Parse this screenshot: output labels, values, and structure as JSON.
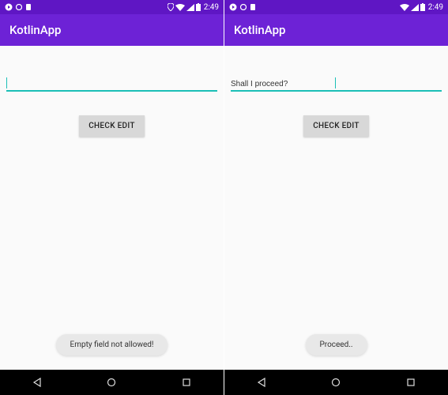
{
  "screens": [
    {
      "statusbar": {
        "time": "2:49"
      },
      "appbar": {
        "title": "KotlinApp"
      },
      "input": {
        "value": "",
        "has_cursor": true
      },
      "button": {
        "label": "CHECK EDIT"
      },
      "toast": {
        "message": "Empty field not allowed!"
      },
      "show_location_icon": true
    },
    {
      "statusbar": {
        "time": "2:49"
      },
      "appbar": {
        "title": "KotlinApp"
      },
      "input": {
        "value": "Shall I proceed?",
        "has_cursor": true
      },
      "button": {
        "label": "CHECK EDIT"
      },
      "toast": {
        "message": "Proceed.."
      },
      "show_location_icon": false
    }
  ]
}
